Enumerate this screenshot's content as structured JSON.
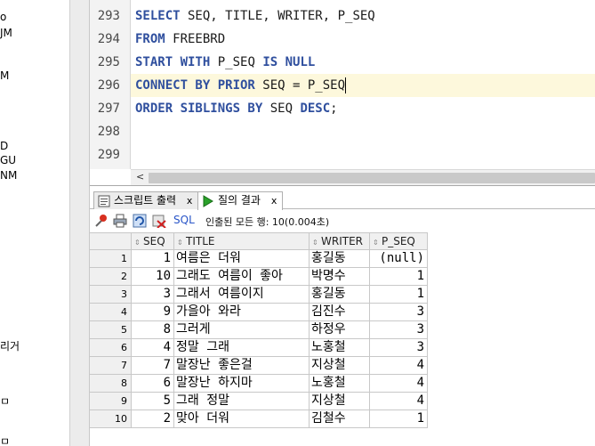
{
  "left_tree": {
    "items": [
      "o",
      "JM",
      "M",
      "D",
      "GU",
      "NM",
      "리거",
      "ㅁ",
      "ㅁ"
    ]
  },
  "editor": {
    "lines": [
      {
        "number": "293",
        "segments": [
          [
            "SELECT",
            "kw"
          ],
          [
            " SEQ, TITLE, WRITER, P_SEQ",
            ""
          ]
        ]
      },
      {
        "number": "294",
        "segments": [
          [
            "FROM",
            "kw"
          ],
          [
            " FREEBRD",
            ""
          ]
        ]
      },
      {
        "number": "295",
        "segments": [
          [
            "START WITH",
            "kw"
          ],
          [
            " P_SEQ ",
            ""
          ],
          [
            "IS NULL",
            "kw"
          ]
        ]
      },
      {
        "number": "296",
        "segments": [
          [
            "CONNECT BY PRIOR",
            "kw"
          ],
          [
            " SEQ = P_SEQ",
            ""
          ]
        ]
      },
      {
        "number": "297",
        "segments": [
          [
            "ORDER SIBLINGS BY",
            "kw"
          ],
          [
            " SEQ ",
            ""
          ],
          [
            "DESC",
            "kw"
          ],
          [
            ";",
            ""
          ]
        ]
      },
      {
        "number": "298",
        "segments": []
      },
      {
        "number": "299",
        "segments": []
      }
    ],
    "scroll_left_arrow": "<"
  },
  "tabs": [
    {
      "label": "스크립트 출력",
      "close": "x",
      "icon": "script-output-icon"
    },
    {
      "label": "질의 결과",
      "close": "x",
      "icon": "run-query-icon"
    }
  ],
  "toolbar": {
    "sql_label": "SQL",
    "status": "인출된 모든 행: 10(0.004초)"
  },
  "grid": {
    "columns": [
      "SEQ",
      "TITLE",
      "WRITER",
      "P_SEQ"
    ],
    "rows": [
      {
        "n": "1",
        "seq": "1",
        "title": "여름은 더워",
        "writer": "홍길동",
        "pseq": "(null)"
      },
      {
        "n": "2",
        "seq": "10",
        "title": "그래도 여름이 좋아",
        "writer": "박명수",
        "pseq": "1"
      },
      {
        "n": "3",
        "seq": "3",
        "title": "그래서 여름이지",
        "writer": "홍길동",
        "pseq": "1"
      },
      {
        "n": "4",
        "seq": "9",
        "title": "가을아 와라",
        "writer": "김진수",
        "pseq": "3"
      },
      {
        "n": "5",
        "seq": "8",
        "title": "그러게",
        "writer": "하정우",
        "pseq": "3"
      },
      {
        "n": "6",
        "seq": "4",
        "title": "정말 그래",
        "writer": "노홍철",
        "pseq": "3"
      },
      {
        "n": "7",
        "seq": "7",
        "title": "말장난 좋은걸",
        "writer": "지상철",
        "pseq": "4"
      },
      {
        "n": "8",
        "seq": "6",
        "title": "말장난 하지마",
        "writer": "노홍철",
        "pseq": "4"
      },
      {
        "n": "9",
        "seq": "5",
        "title": "그래 정말",
        "writer": "지상철",
        "pseq": "4"
      },
      {
        "n": "10",
        "seq": "2",
        "title": "맞아 더워",
        "writer": "김철수",
        "pseq": "1"
      }
    ]
  }
}
